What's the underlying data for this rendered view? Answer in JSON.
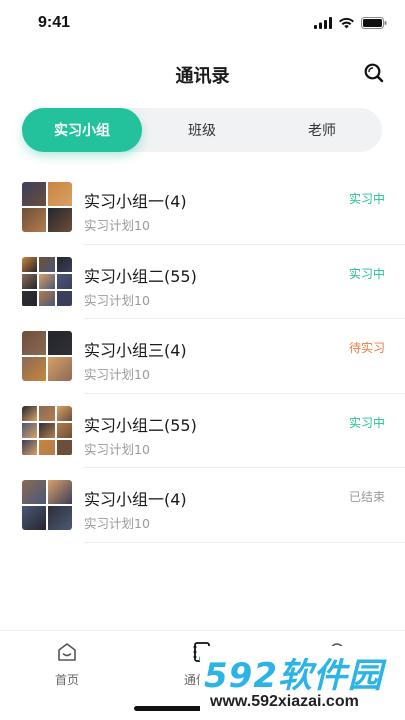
{
  "status_bar": {
    "time": "9:41"
  },
  "header": {
    "title": "通讯录"
  },
  "tabs": [
    {
      "label": "实习小组",
      "active": true
    },
    {
      "label": "班级",
      "active": false
    },
    {
      "label": "老师",
      "active": false
    }
  ],
  "groups": [
    {
      "title": "实习小组一(4)",
      "subtitle": "实习计划10",
      "status": "实习中",
      "status_color": "#23c29c",
      "avatar_count": 4
    },
    {
      "title": "实习小组二(55)",
      "subtitle": "实习计划10",
      "status": "实习中",
      "status_color": "#23c29c",
      "avatar_count": 9
    },
    {
      "title": "实习小组三(4)",
      "subtitle": "实习计划10",
      "status": "待实习",
      "status_color": "#f07a3c",
      "avatar_count": 4
    },
    {
      "title": "实习小组二(55)",
      "subtitle": "实习计划10",
      "status": "实习中",
      "status_color": "#23c29c",
      "avatar_count": 9
    },
    {
      "title": "实习小组一(4)",
      "subtitle": "实习计划10",
      "status": "已结束",
      "status_color": "#9a9a9a",
      "avatar_count": 4
    }
  ],
  "bottom_nav": [
    {
      "label": "首页",
      "icon": "home-icon"
    },
    {
      "label": "通信录",
      "icon": "contacts-icon"
    },
    {
      "label": "",
      "icon": "profile-icon"
    }
  ],
  "watermark": {
    "logo": "592软件园",
    "url": "www.592xiazai.com"
  },
  "colors": {
    "accent": "#23c29c",
    "pending": "#f07a3c",
    "ended": "#9a9a9a"
  }
}
